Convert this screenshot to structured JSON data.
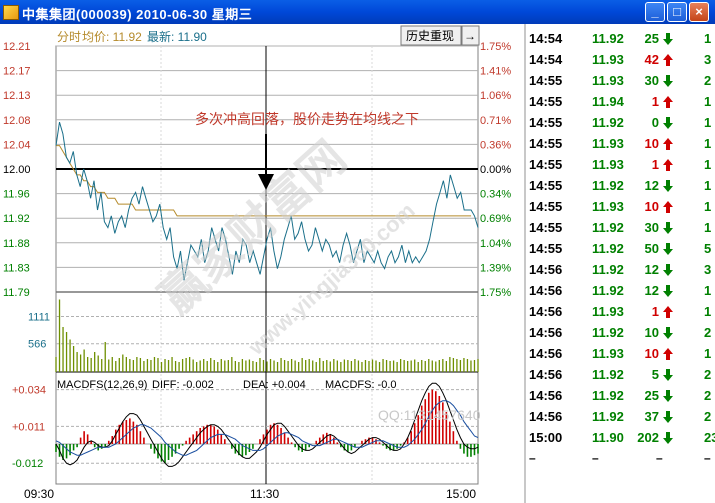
{
  "window": {
    "title": "中集集团(000039) 2010-06-30 星期三",
    "minimize": "_",
    "maximize": "□",
    "close": "×"
  },
  "header": {
    "label_fenshi": "分时",
    "label_avg": "均价: 11.92",
    "label_latest": "最新: 11.90",
    "history_button": "历史重现",
    "nav_arrow": "→"
  },
  "price_axis": [
    "12.21",
    "12.17",
    "12.13",
    "12.08",
    "12.04",
    "12.00",
    "11.96",
    "11.92",
    "11.88",
    "11.83",
    "11.79"
  ],
  "pct_axis": [
    "1.75%",
    "1.41%",
    "1.06%",
    "0.71%",
    "0.36%",
    "0.00%",
    "0.34%",
    "0.69%",
    "1.04%",
    "1.39%",
    "1.75%"
  ],
  "volume_axis": [
    "1111",
    "566"
  ],
  "macd_axis": [
    "+0.034",
    "+0.011",
    "-0.012"
  ],
  "macd_legend": {
    "name": "MACDFS(12,26,9)",
    "diff": "DIFF: -0.002",
    "dea": "DEA: +0.004",
    "macdfs": "MACDFS: -0.0"
  },
  "time_axis": [
    "09:30",
    "11:30",
    "15:00"
  ],
  "annotation": "多次冲高回落，股价走势在均线之下",
  "watermark_qq": "QQ:1131457640",
  "watermark_site": "赢家财富网",
  "watermark_url": "www.yingjia360.com",
  "colors": {
    "price_line": "#1a6f8a",
    "avg_line": "#b58a2a",
    "up": "#d00000",
    "down": "#008000",
    "vol_bar": "#6e8f00",
    "grid": "#b0b0b0",
    "annotation": "#c0392b"
  },
  "chart_data": {
    "type": "line",
    "title": "中集集团(000039) 2010-06-30",
    "price_ylim": [
      11.79,
      12.21
    ],
    "prev_close": 12.0,
    "price_series": [
      12.04,
      12.08,
      12.06,
      12.02,
      12.01,
      12.03,
      11.99,
      11.97,
      12.0,
      11.98,
      11.95,
      11.98,
      11.93,
      11.96,
      11.91,
      11.9,
      11.92,
      11.89,
      11.91,
      11.92,
      11.9,
      11.93,
      11.95,
      11.96,
      11.94,
      11.97,
      11.95,
      11.93,
      11.91,
      11.92,
      11.94,
      11.9,
      11.88,
      11.9,
      11.85,
      11.83,
      11.86,
      11.81,
      11.84,
      11.87,
      11.86,
      11.85,
      11.88,
      11.84,
      11.86,
      11.9,
      11.88,
      11.86,
      11.9,
      11.88,
      11.85,
      11.82,
      11.86,
      11.84,
      11.88,
      11.87,
      11.84,
      11.86,
      11.84,
      11.82,
      11.85,
      11.88,
      11.9,
      11.86,
      11.83,
      11.85,
      11.88,
      11.9,
      11.92,
      11.88,
      11.89,
      11.91,
      11.88,
      11.86,
      11.87,
      11.9,
      11.88,
      11.86,
      11.88,
      11.87,
      11.85,
      11.86,
      11.84,
      11.87,
      11.89,
      11.87,
      11.84,
      11.86,
      11.88,
      11.84,
      11.86,
      11.85,
      11.84,
      11.86,
      11.84,
      11.83,
      11.85,
      11.86,
      11.84,
      11.85,
      11.87,
      11.84,
      11.86,
      11.84,
      11.85,
      11.84,
      11.85,
      11.86,
      11.88,
      11.91,
      11.94,
      11.96,
      11.98,
      11.95,
      11.99,
      11.97,
      11.95,
      11.96,
      11.93,
      11.93,
      11.93,
      11.92,
      11.9
    ],
    "avg_series": [
      12.04,
      12.04,
      12.03,
      12.02,
      12.01,
      12.0,
      11.99,
      11.99,
      11.98,
      11.98,
      11.97,
      11.97,
      11.96,
      11.96,
      11.96,
      11.95,
      11.95,
      11.95,
      11.94,
      11.94,
      11.94,
      11.94,
      11.94,
      11.93,
      11.93,
      11.93,
      11.93,
      11.93,
      11.93,
      11.93,
      11.93,
      11.93,
      11.93,
      11.93,
      11.93,
      11.92,
      11.92,
      11.92,
      11.92,
      11.92,
      11.92,
      11.92,
      11.92,
      11.92,
      11.92,
      11.92,
      11.92,
      11.92,
      11.92,
      11.92,
      11.92,
      11.92,
      11.92,
      11.92,
      11.92,
      11.92,
      11.92,
      11.92,
      11.92,
      11.92,
      11.92,
      11.92,
      11.92,
      11.92,
      11.92,
      11.92,
      11.92,
      11.92,
      11.92,
      11.92,
      11.92,
      11.92,
      11.92,
      11.92,
      11.92,
      11.92,
      11.92,
      11.92,
      11.92,
      11.92,
      11.92,
      11.92,
      11.92,
      11.92,
      11.92,
      11.92,
      11.92,
      11.92,
      11.92,
      11.92,
      11.92,
      11.92,
      11.92,
      11.92,
      11.92,
      11.92,
      11.92,
      11.92,
      11.92,
      11.92,
      11.92,
      11.92,
      11.92,
      11.92,
      11.92,
      11.92,
      11.92,
      11.92,
      11.92,
      11.92,
      11.92,
      11.92,
      11.92,
      11.92,
      11.92,
      11.92,
      11.92,
      11.92,
      11.92,
      11.92,
      11.92
    ],
    "volume_ylim": [
      0,
      1600
    ],
    "volume_series": [
      300,
      1450,
      900,
      800,
      650,
      520,
      400,
      350,
      450,
      300,
      280,
      400,
      330,
      260,
      600,
      250,
      300,
      220,
      280,
      350,
      300,
      260,
      240,
      300,
      280,
      220,
      260,
      240,
      300,
      280,
      200,
      260,
      240,
      300,
      220,
      200,
      260,
      280,
      300,
      250,
      200,
      230,
      260,
      220,
      280,
      240,
      200,
      260,
      230,
      240,
      300,
      220,
      200,
      260,
      230,
      250,
      220,
      200,
      280,
      240,
      210,
      260,
      230,
      200,
      280,
      240,
      220,
      260,
      230,
      200,
      280,
      240,
      260,
      230,
      200,
      280,
      220,
      240,
      210,
      260,
      230,
      200,
      250,
      240,
      220,
      260,
      230,
      200,
      240,
      220,
      250,
      230,
      200,
      260,
      240,
      220,
      230,
      200,
      260,
      240,
      220,
      230,
      250,
      200,
      240,
      220,
      260,
      230,
      210,
      240,
      260,
      220,
      300,
      280,
      260,
      240,
      280,
      260,
      230,
      240,
      260
    ],
    "macd_ylim": [
      -0.025,
      0.045
    ],
    "macd_series": [
      -0.005,
      -0.008,
      -0.01,
      -0.009,
      -0.007,
      -0.004,
      -0.002,
      0.004,
      0.008,
      0.006,
      0.002,
      -0.002,
      -0.004,
      -0.003,
      -0.002,
      0.002,
      0.005,
      0.009,
      0.012,
      0.014,
      0.015,
      0.016,
      0.014,
      0.012,
      0.008,
      0.004,
      0.0,
      -0.003,
      -0.006,
      -0.009,
      -0.011,
      -0.012,
      -0.01,
      -0.008,
      -0.006,
      -0.003,
      -0.001,
      0.002,
      0.004,
      0.006,
      0.008,
      0.01,
      0.011,
      0.012,
      0.012,
      0.011,
      0.009,
      0.006,
      0.003,
      0.0,
      -0.003,
      -0.006,
      -0.007,
      -0.008,
      -0.007,
      -0.005,
      -0.003,
      0.0,
      0.003,
      0.006,
      0.009,
      0.012,
      0.013,
      0.012,
      0.01,
      0.007,
      0.004,
      0.001,
      -0.002,
      -0.004,
      -0.005,
      -0.004,
      -0.002,
      0.0,
      0.002,
      0.004,
      0.006,
      0.007,
      0.006,
      0.004,
      0.001,
      -0.002,
      -0.004,
      -0.005,
      -0.004,
      -0.002,
      0.0,
      0.002,
      0.003,
      0.004,
      0.004,
      0.003,
      0.001,
      -0.001,
      -0.003,
      -0.004,
      -0.004,
      -0.003,
      -0.001,
      0.001,
      0.004,
      0.008,
      0.013,
      0.018,
      0.024,
      0.028,
      0.032,
      0.034,
      0.033,
      0.03,
      0.026,
      0.02,
      0.014,
      0.008,
      0.002,
      -0.003,
      -0.006,
      -0.008,
      -0.008,
      -0.007,
      -0.006
    ],
    "diff_series": [
      0.0,
      -0.004,
      -0.009,
      -0.012,
      -0.013,
      -0.012,
      -0.01,
      -0.006,
      -0.002,
      0.001,
      0.002,
      0.001,
      -0.001,
      -0.002,
      -0.002,
      -0.001,
      0.002,
      0.006,
      0.01,
      0.014,
      0.017,
      0.019,
      0.019,
      0.018,
      0.015,
      0.011,
      0.007,
      0.003,
      -0.001,
      -0.005,
      -0.009,
      -0.012,
      -0.014,
      -0.014,
      -0.013,
      -0.011,
      -0.008,
      -0.005,
      -0.002,
      0.001,
      0.004,
      0.007,
      0.009,
      0.011,
      0.012,
      0.012,
      0.011,
      0.009,
      0.006,
      0.003,
      0.0,
      -0.003,
      -0.006,
      -0.008,
      -0.009,
      -0.009,
      -0.007,
      -0.005,
      -0.002,
      0.002,
      0.006,
      0.009,
      0.012,
      0.013,
      0.013,
      0.011,
      0.008,
      0.005,
      0.002,
      -0.001,
      -0.003,
      -0.004,
      -0.004,
      -0.003,
      -0.001,
      0.001,
      0.003,
      0.005,
      0.006,
      0.005,
      0.003,
      0.0,
      -0.003,
      -0.005,
      -0.006,
      -0.005,
      -0.003,
      -0.001,
      0.001,
      0.003,
      0.004,
      0.004,
      0.003,
      0.001,
      -0.001,
      -0.003,
      -0.004,
      -0.004,
      -0.003,
      0.0,
      0.004,
      0.009,
      0.015,
      0.021,
      0.027,
      0.032,
      0.036,
      0.038,
      0.038,
      0.036,
      0.032,
      0.027,
      0.021,
      0.015,
      0.009,
      0.004,
      0.0,
      -0.002,
      -0.003,
      -0.003,
      -0.002
    ],
    "dea_series": [
      0.002,
      0.001,
      -0.001,
      -0.003,
      -0.005,
      -0.006,
      -0.007,
      -0.007,
      -0.006,
      -0.005,
      -0.004,
      -0.003,
      -0.002,
      -0.002,
      -0.002,
      -0.002,
      -0.001,
      0.0,
      0.002,
      0.004,
      0.006,
      0.008,
      0.01,
      0.011,
      0.012,
      0.012,
      0.011,
      0.01,
      0.008,
      0.006,
      0.004,
      0.001,
      -0.001,
      -0.003,
      -0.005,
      -0.006,
      -0.007,
      -0.007,
      -0.006,
      -0.005,
      -0.004,
      -0.002,
      0.0,
      0.002,
      0.004,
      0.005,
      0.006,
      0.006,
      0.006,
      0.005,
      0.004,
      0.003,
      0.001,
      -0.001,
      -0.002,
      -0.003,
      -0.004,
      -0.004,
      -0.004,
      -0.003,
      -0.001,
      0.001,
      0.003,
      0.005,
      0.006,
      0.007,
      0.007,
      0.006,
      0.005,
      0.004,
      0.002,
      0.001,
      0.0,
      -0.001,
      -0.001,
      -0.001,
      0.0,
      0.001,
      0.002,
      0.003,
      0.003,
      0.002,
      0.001,
      0.0,
      -0.001,
      -0.002,
      -0.002,
      -0.002,
      -0.001,
      0.0,
      0.001,
      0.002,
      0.002,
      0.002,
      0.001,
      0.0,
      -0.001,
      -0.002,
      -0.002,
      -0.002,
      -0.001,
      0.001,
      0.003,
      0.006,
      0.009,
      0.013,
      0.017,
      0.021,
      0.024,
      0.026,
      0.027,
      0.027,
      0.026,
      0.024,
      0.021,
      0.018,
      0.014,
      0.011,
      0.008,
      0.005,
      0.004
    ]
  },
  "ticks": [
    {
      "time": "14:54",
      "price": "11.92",
      "vol": "25",
      "dir": "down",
      "last": "1"
    },
    {
      "time": "14:54",
      "price": "11.93",
      "vol": "42",
      "dir": "up",
      "last": "3"
    },
    {
      "time": "14:55",
      "price": "11.93",
      "vol": "30",
      "dir": "down",
      "last": "2"
    },
    {
      "time": "14:55",
      "price": "11.94",
      "vol": "1",
      "dir": "up",
      "last": "1"
    },
    {
      "time": "14:55",
      "price": "11.92",
      "vol": "0",
      "dir": "down",
      "last": "1"
    },
    {
      "time": "14:55",
      "price": "11.93",
      "vol": "10",
      "dir": "up",
      "last": "1"
    },
    {
      "time": "14:55",
      "price": "11.93",
      "vol": "1",
      "dir": "up",
      "last": "1"
    },
    {
      "time": "14:55",
      "price": "11.92",
      "vol": "12",
      "dir": "down",
      "last": "1"
    },
    {
      "time": "14:55",
      "price": "11.93",
      "vol": "10",
      "dir": "up",
      "last": "1"
    },
    {
      "time": "14:55",
      "price": "11.92",
      "vol": "30",
      "dir": "down",
      "last": "1"
    },
    {
      "time": "14:55",
      "price": "11.92",
      "vol": "50",
      "dir": "down",
      "last": "5"
    },
    {
      "time": "14:56",
      "price": "11.92",
      "vol": "12",
      "dir": "down",
      "last": "3"
    },
    {
      "time": "14:56",
      "price": "11.92",
      "vol": "12",
      "dir": "down",
      "last": "1"
    },
    {
      "time": "14:56",
      "price": "11.93",
      "vol": "1",
      "dir": "up",
      "last": "1"
    },
    {
      "time": "14:56",
      "price": "11.92",
      "vol": "10",
      "dir": "down",
      "last": "2"
    },
    {
      "time": "14:56",
      "price": "11.93",
      "vol": "10",
      "dir": "up",
      "last": "1"
    },
    {
      "time": "14:56",
      "price": "11.92",
      "vol": "5",
      "dir": "down",
      "last": "2"
    },
    {
      "time": "14:56",
      "price": "11.92",
      "vol": "25",
      "dir": "down",
      "last": "2"
    },
    {
      "time": "14:56",
      "price": "11.92",
      "vol": "37",
      "dir": "down",
      "last": "2"
    },
    {
      "time": "15:00",
      "price": "11.90",
      "vol": "202",
      "dir": "down",
      "last": "23"
    }
  ],
  "tick_empty": "–"
}
